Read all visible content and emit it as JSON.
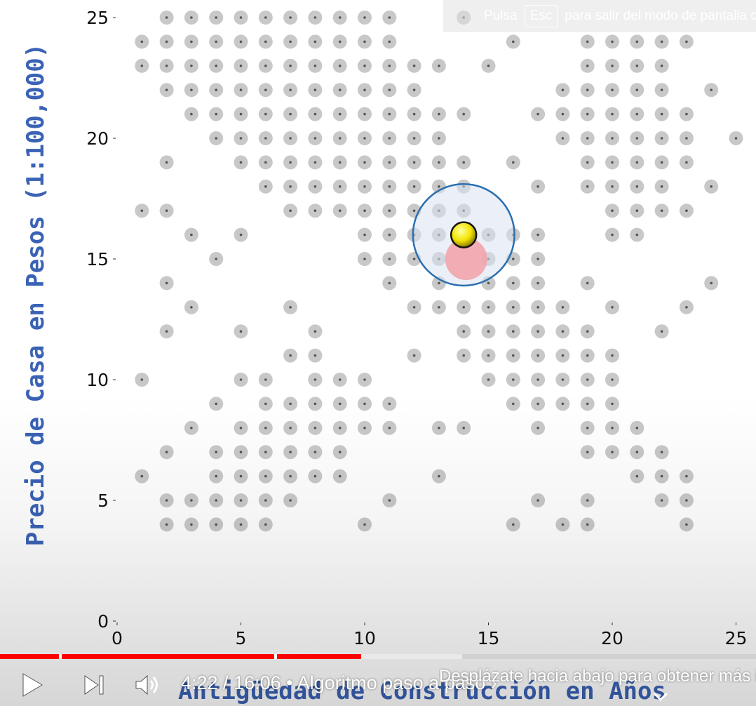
{
  "chart_data": {
    "type": "scatter",
    "title": "",
    "xlabel": "Antigüedad de Construcción en Años",
    "ylabel": "Precio de Casa en Pesos (1:100,000)",
    "xlim": [
      0,
      25.5
    ],
    "ylim": [
      0,
      25.5
    ],
    "x_ticks": [
      "0",
      "5",
      "10",
      "15",
      "20",
      "25"
    ],
    "y_ticks": [
      "0",
      "5",
      "10",
      "15",
      "20",
      "25"
    ],
    "grid": false,
    "point_color": "#c8c8c8",
    "points": [
      [
        2,
        25
      ],
      [
        3,
        25
      ],
      [
        4,
        25
      ],
      [
        5,
        25
      ],
      [
        6,
        25
      ],
      [
        7,
        25
      ],
      [
        8,
        25
      ],
      [
        9,
        25
      ],
      [
        10,
        25
      ],
      [
        11,
        25
      ],
      [
        14,
        25
      ],
      [
        1,
        24
      ],
      [
        2,
        24
      ],
      [
        3,
        24
      ],
      [
        4,
        24
      ],
      [
        5,
        24
      ],
      [
        6,
        24
      ],
      [
        7,
        24
      ],
      [
        8,
        24
      ],
      [
        9,
        24
      ],
      [
        10,
        24
      ],
      [
        11,
        24
      ],
      [
        16,
        24
      ],
      [
        19,
        24
      ],
      [
        20,
        24
      ],
      [
        21,
        24
      ],
      [
        22,
        24
      ],
      [
        23,
        24
      ],
      [
        1,
        23
      ],
      [
        2,
        23
      ],
      [
        3,
        23
      ],
      [
        4,
        23
      ],
      [
        5,
        23
      ],
      [
        6,
        23
      ],
      [
        7,
        23
      ],
      [
        8,
        23
      ],
      [
        9,
        23
      ],
      [
        10,
        23
      ],
      [
        11,
        23
      ],
      [
        12,
        23
      ],
      [
        13,
        23
      ],
      [
        15,
        23
      ],
      [
        19,
        23
      ],
      [
        20,
        23
      ],
      [
        21,
        23
      ],
      [
        22,
        23
      ],
      [
        2,
        22
      ],
      [
        3,
        22
      ],
      [
        4,
        22
      ],
      [
        5,
        22
      ],
      [
        6,
        22
      ],
      [
        7,
        22
      ],
      [
        8,
        22
      ],
      [
        9,
        22
      ],
      [
        10,
        22
      ],
      [
        11,
        22
      ],
      [
        12,
        22
      ],
      [
        18,
        22
      ],
      [
        19,
        22
      ],
      [
        20,
        22
      ],
      [
        21,
        22
      ],
      [
        22,
        22
      ],
      [
        24,
        22
      ],
      [
        3,
        21
      ],
      [
        4,
        21
      ],
      [
        5,
        21
      ],
      [
        6,
        21
      ],
      [
        7,
        21
      ],
      [
        8,
        21
      ],
      [
        9,
        21
      ],
      [
        10,
        21
      ],
      [
        11,
        21
      ],
      [
        12,
        21
      ],
      [
        13,
        21
      ],
      [
        14,
        21
      ],
      [
        17,
        21
      ],
      [
        18,
        21
      ],
      [
        19,
        21
      ],
      [
        20,
        21
      ],
      [
        21,
        21
      ],
      [
        22,
        21
      ],
      [
        23,
        21
      ],
      [
        4,
        20
      ],
      [
        5,
        20
      ],
      [
        6,
        20
      ],
      [
        7,
        20
      ],
      [
        8,
        20
      ],
      [
        9,
        20
      ],
      [
        10,
        20
      ],
      [
        11,
        20
      ],
      [
        12,
        20
      ],
      [
        13,
        20
      ],
      [
        18,
        20
      ],
      [
        19,
        20
      ],
      [
        20,
        20
      ],
      [
        21,
        20
      ],
      [
        22,
        20
      ],
      [
        23,
        20
      ],
      [
        25,
        20
      ],
      [
        2,
        19
      ],
      [
        5,
        19
      ],
      [
        6,
        19
      ],
      [
        7,
        19
      ],
      [
        8,
        19
      ],
      [
        9,
        19
      ],
      [
        10,
        19
      ],
      [
        11,
        19
      ],
      [
        12,
        19
      ],
      [
        13,
        19
      ],
      [
        14,
        19
      ],
      [
        16,
        19
      ],
      [
        19,
        19
      ],
      [
        20,
        19
      ],
      [
        21,
        19
      ],
      [
        22,
        19
      ],
      [
        23,
        19
      ],
      [
        6,
        18
      ],
      [
        7,
        18
      ],
      [
        8,
        18
      ],
      [
        9,
        18
      ],
      [
        10,
        18
      ],
      [
        11,
        18
      ],
      [
        12,
        18
      ],
      [
        13,
        18
      ],
      [
        14,
        18
      ],
      [
        17,
        18
      ],
      [
        19,
        18
      ],
      [
        20,
        18
      ],
      [
        21,
        18
      ],
      [
        22,
        18
      ],
      [
        24,
        18
      ],
      [
        1,
        17
      ],
      [
        2,
        17
      ],
      [
        7,
        17
      ],
      [
        8,
        17
      ],
      [
        9,
        17
      ],
      [
        10,
        17
      ],
      [
        11,
        17
      ],
      [
        12,
        17
      ],
      [
        13,
        17
      ],
      [
        14,
        17
      ],
      [
        20,
        17
      ],
      [
        21,
        17
      ],
      [
        22,
        17
      ],
      [
        23,
        17
      ],
      [
        3,
        16
      ],
      [
        5,
        16
      ],
      [
        10,
        16
      ],
      [
        11,
        16
      ],
      [
        12,
        16
      ],
      [
        13,
        16
      ],
      [
        15,
        16
      ],
      [
        16,
        16
      ],
      [
        17,
        16
      ],
      [
        20,
        16
      ],
      [
        21,
        16
      ],
      [
        4,
        15
      ],
      [
        10,
        15
      ],
      [
        11,
        15
      ],
      [
        12,
        15
      ],
      [
        13,
        15
      ],
      [
        15,
        15
      ],
      [
        16,
        15
      ],
      [
        17,
        15
      ],
      [
        2,
        14
      ],
      [
        11,
        14
      ],
      [
        13,
        14
      ],
      [
        15,
        14
      ],
      [
        16,
        14
      ],
      [
        17,
        14
      ],
      [
        19,
        14
      ],
      [
        24,
        14
      ],
      [
        3,
        13
      ],
      [
        7,
        13
      ],
      [
        12,
        13
      ],
      [
        13,
        13
      ],
      [
        14,
        13
      ],
      [
        15,
        13
      ],
      [
        16,
        13
      ],
      [
        17,
        13
      ],
      [
        18,
        13
      ],
      [
        20,
        13
      ],
      [
        23,
        13
      ],
      [
        2,
        12
      ],
      [
        5,
        12
      ],
      [
        8,
        12
      ],
      [
        14,
        12
      ],
      [
        15,
        12
      ],
      [
        16,
        12
      ],
      [
        17,
        12
      ],
      [
        18,
        12
      ],
      [
        19,
        12
      ],
      [
        22,
        12
      ],
      [
        7,
        11
      ],
      [
        8,
        11
      ],
      [
        12,
        11
      ],
      [
        14,
        11
      ],
      [
        15,
        11
      ],
      [
        16,
        11
      ],
      [
        17,
        11
      ],
      [
        18,
        11
      ],
      [
        19,
        11
      ],
      [
        20,
        11
      ],
      [
        1,
        10
      ],
      [
        5,
        10
      ],
      [
        6,
        10
      ],
      [
        8,
        10
      ],
      [
        9,
        10
      ],
      [
        10,
        10
      ],
      [
        15,
        10
      ],
      [
        16,
        10
      ],
      [
        17,
        10
      ],
      [
        18,
        10
      ],
      [
        19,
        10
      ],
      [
        20,
        10
      ],
      [
        4,
        9
      ],
      [
        6,
        9
      ],
      [
        7,
        9
      ],
      [
        8,
        9
      ],
      [
        9,
        9
      ],
      [
        10,
        9
      ],
      [
        11,
        9
      ],
      [
        16,
        9
      ],
      [
        17,
        9
      ],
      [
        18,
        9
      ],
      [
        19,
        9
      ],
      [
        20,
        9
      ],
      [
        3,
        8
      ],
      [
        5,
        8
      ],
      [
        6,
        8
      ],
      [
        7,
        8
      ],
      [
        8,
        8
      ],
      [
        9,
        8
      ],
      [
        10,
        8
      ],
      [
        11,
        8
      ],
      [
        13,
        8
      ],
      [
        14,
        8
      ],
      [
        17,
        8
      ],
      [
        19,
        8
      ],
      [
        20,
        8
      ],
      [
        21,
        8
      ],
      [
        2,
        7
      ],
      [
        4,
        7
      ],
      [
        5,
        7
      ],
      [
        6,
        7
      ],
      [
        7,
        7
      ],
      [
        8,
        7
      ],
      [
        9,
        7
      ],
      [
        19,
        7
      ],
      [
        20,
        7
      ],
      [
        21,
        7
      ],
      [
        22,
        7
      ],
      [
        1,
        6
      ],
      [
        4,
        6
      ],
      [
        5,
        6
      ],
      [
        6,
        6
      ],
      [
        7,
        6
      ],
      [
        8,
        6
      ],
      [
        9,
        6
      ],
      [
        13,
        6
      ],
      [
        21,
        6
      ],
      [
        22,
        6
      ],
      [
        23,
        6
      ],
      [
        2,
        5
      ],
      [
        3,
        5
      ],
      [
        4,
        5
      ],
      [
        5,
        5
      ],
      [
        6,
        5
      ],
      [
        7,
        5
      ],
      [
        11,
        5
      ],
      [
        17,
        5
      ],
      [
        19,
        5
      ],
      [
        22,
        5
      ],
      [
        23,
        5
      ],
      [
        2,
        4
      ],
      [
        3,
        4
      ],
      [
        4,
        4
      ],
      [
        5,
        4
      ],
      [
        6,
        4
      ],
      [
        10,
        4
      ],
      [
        16,
        4
      ],
      [
        18,
        4
      ],
      [
        19,
        4
      ],
      [
        23,
        4
      ]
    ],
    "highlight": {
      "query_point": [
        14,
        16
      ],
      "query_color": "#f2e200",
      "nearest_point": [
        14.1,
        15
      ],
      "nearest_color": "#f2a0a8",
      "circle_radius": 2.05,
      "circle_stroke": "#2a6fb0",
      "circle_fill": "#dbe4f3"
    }
  },
  "fullscreen_hint": {
    "pre": "Pulsa",
    "key": "Esc",
    "post": "para salir del modo de pantalla completa"
  },
  "player": {
    "time": "4:22 / 16:06 • Algoritmo paso a paso ›",
    "scroll_hint": "Desplázate hacia abajo para obtener más información",
    "progress_played": 0.478,
    "progress_buffered": 0.611,
    "chapter_marks": [
      0.078,
      0.363
    ],
    "icons": {
      "play": "play-icon",
      "next": "next-icon",
      "volume": "volume-icon",
      "scroll": "chevron-down-icon"
    },
    "accent_color": "#ff0000"
  }
}
